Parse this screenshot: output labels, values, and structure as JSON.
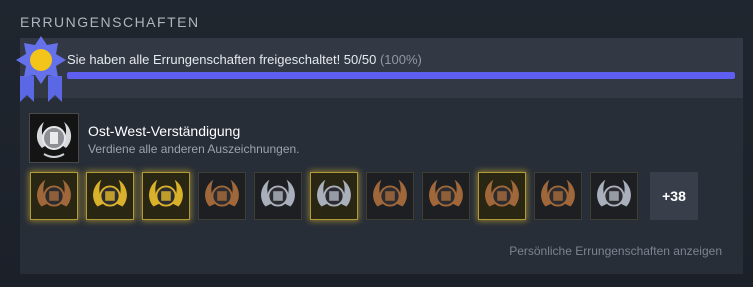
{
  "section": {
    "title": "ERRUNGENSCHAFTEN"
  },
  "progress": {
    "label": "Sie haben alle Errungenschaften freigeschaltet! 50/50",
    "percent_label": "(100%)",
    "value": 1.0,
    "bar_color": "#5e5ff0"
  },
  "featured": {
    "name": "Ost-West-Verständigung",
    "description": "Verdiene alle anderen Auszeichnungen.",
    "icon": "silver-laurel-emblem-icon"
  },
  "achievements": [
    {
      "icon": "bronze-laurel-helmet-icon",
      "tone": "bronze",
      "glow": true
    },
    {
      "icon": "gold-laurel-crown-icon",
      "tone": "gold",
      "glow": true
    },
    {
      "icon": "gold-laurel-crown-icon",
      "tone": "gold",
      "glow": true
    },
    {
      "icon": "bronze-laurel-scroll-icon",
      "tone": "bronze",
      "glow": false
    },
    {
      "icon": "silver-laurel-crown-icon",
      "tone": "silver",
      "glow": false
    },
    {
      "icon": "silver-laurel-castle-icon",
      "tone": "silver",
      "glow": true
    },
    {
      "icon": "bronze-laurel-bag-icon",
      "tone": "bronze",
      "glow": false
    },
    {
      "icon": "bronze-laurel-crown-icon",
      "tone": "bronze",
      "glow": false
    },
    {
      "icon": "bronze-laurel-flower-icon",
      "tone": "bronze",
      "glow": true
    },
    {
      "icon": "bronze-laurel-book-icon",
      "tone": "bronze",
      "glow": false
    },
    {
      "icon": "silver-laurel-shield-icon",
      "tone": "silver",
      "glow": false
    }
  ],
  "more_count": "+38",
  "view_link": "Persönliche Errungenschaften anzeigen",
  "colors": {
    "gold": "#d9b12a",
    "silver": "#a9b0bb",
    "bronze": "#a0683a"
  }
}
